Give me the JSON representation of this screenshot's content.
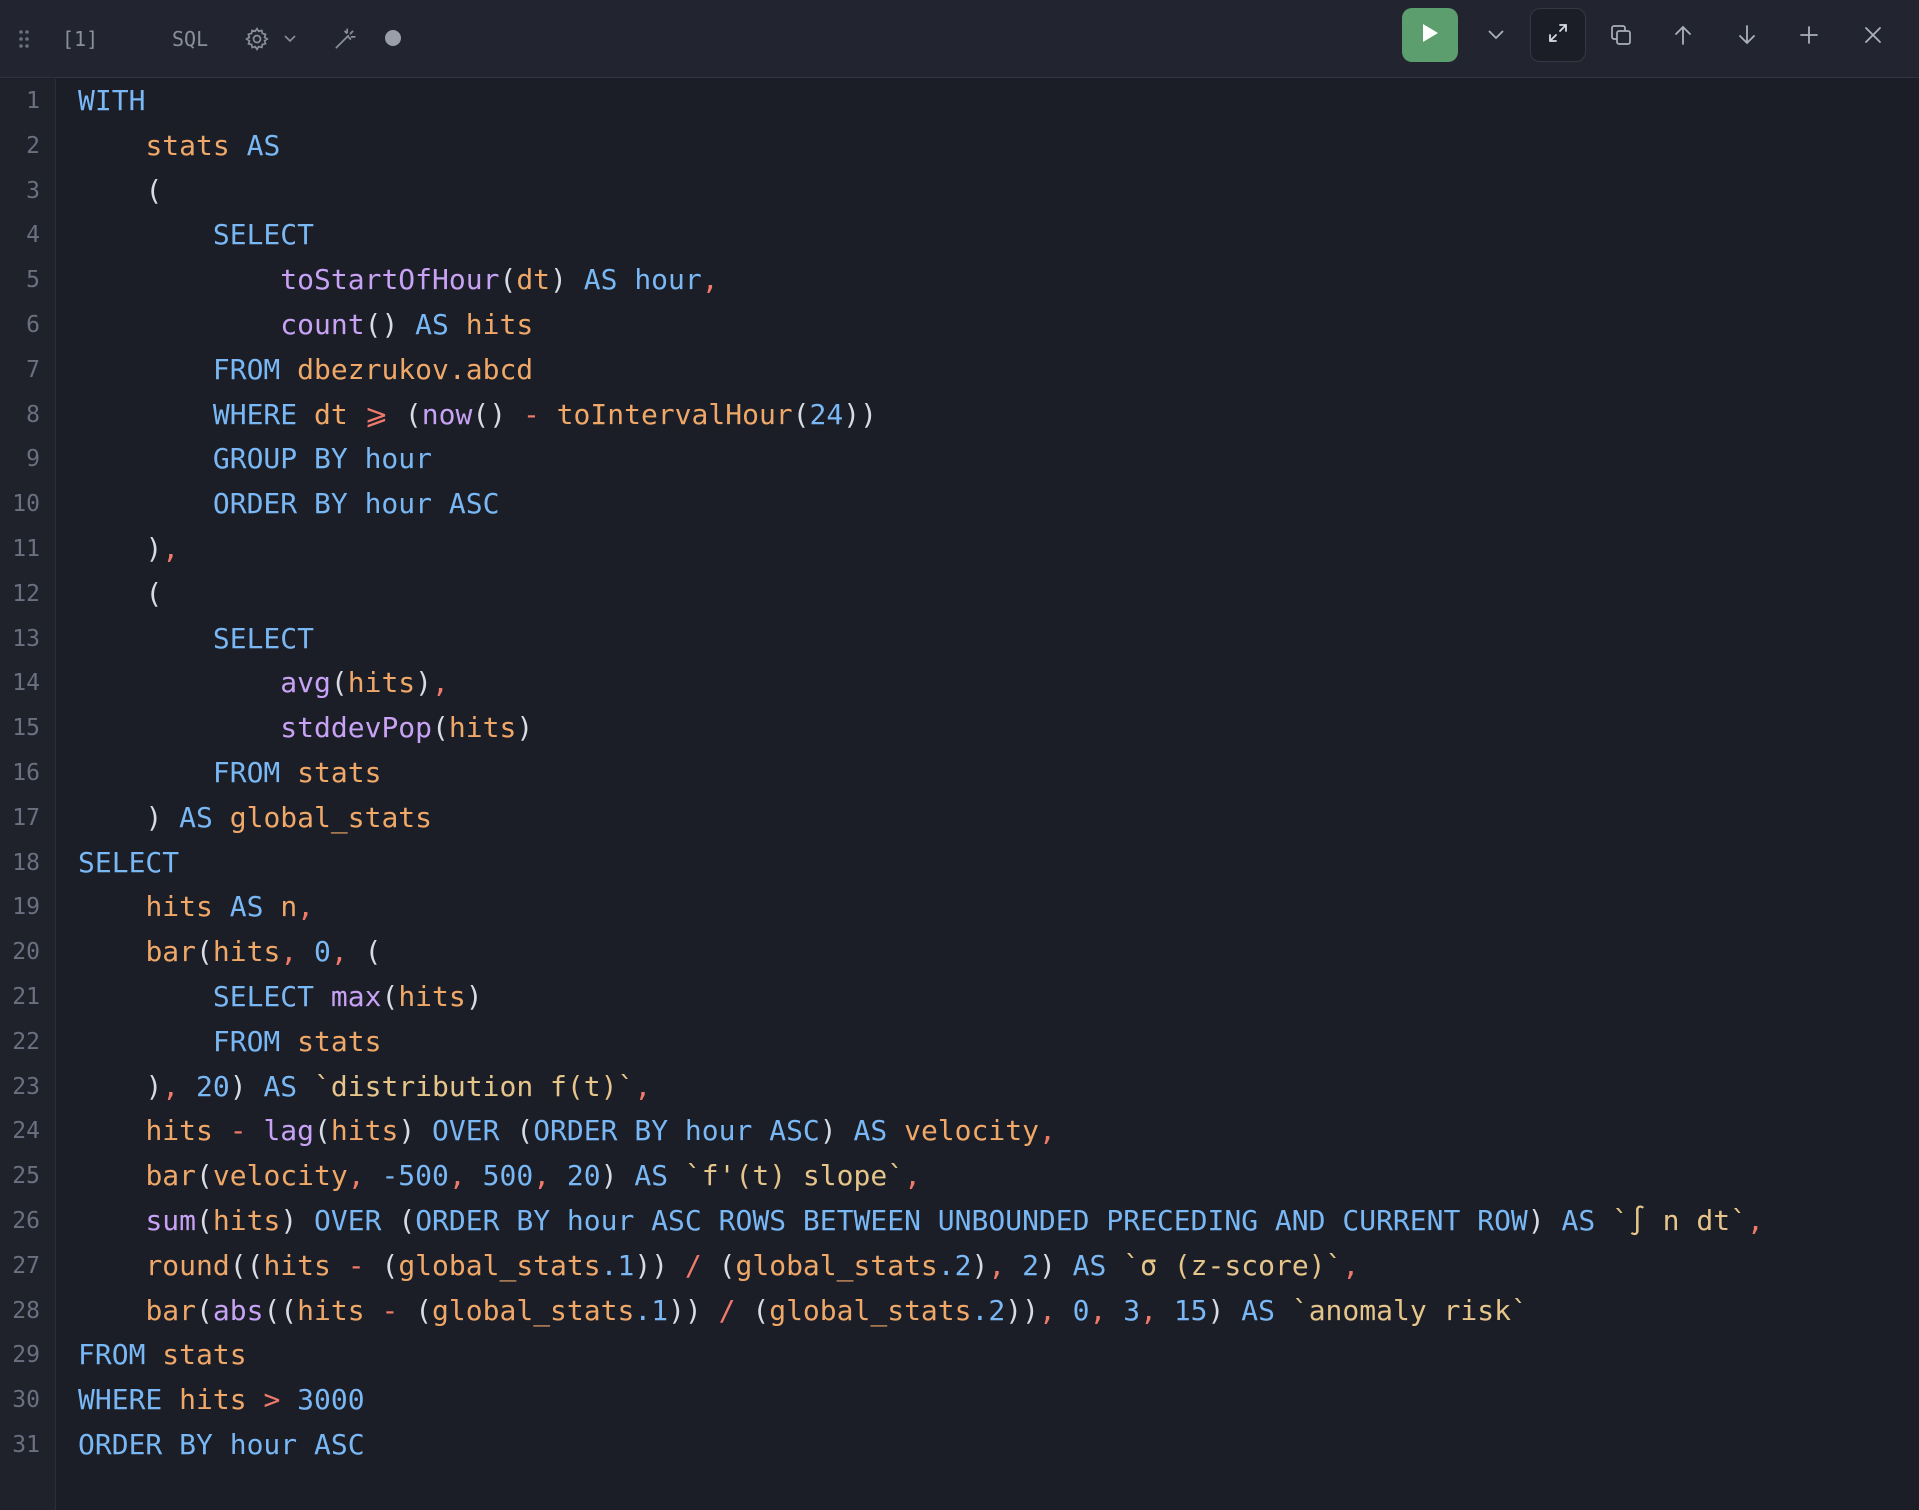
{
  "toolbar": {
    "cell_index": "[1]",
    "language": "SQL",
    "icons": {
      "drag": "drag-handle-icon",
      "settings": "gear-icon",
      "format": "magic-wand-icon",
      "status": "status-dot-icon",
      "run": "play-icon",
      "run_options": "chevron-down-icon",
      "expand": "expand-icon",
      "copy": "copy-icon",
      "move_up": "arrow-up-icon",
      "move_down": "arrow-down-icon",
      "add": "plus-icon",
      "close": "close-icon"
    },
    "colors": {
      "run_button": "#5c9e6e",
      "background": "#22252f"
    }
  },
  "editor": {
    "colors": {
      "keyword": "#79b8f5",
      "function": "#c8a2f5",
      "identifier": "#f0a868",
      "number": "#79b8f5",
      "operator": "#f07a6a",
      "string": "#e6c58a",
      "background": "#1b1e27"
    },
    "lines": [
      [
        [
          "k",
          "WITH"
        ]
      ],
      [
        [
          "w",
          "    "
        ],
        [
          "i",
          "stats"
        ],
        [
          "w",
          " "
        ],
        [
          "k",
          "AS"
        ]
      ],
      [
        [
          "w",
          "    "
        ],
        [
          "p",
          "("
        ]
      ],
      [
        [
          "w",
          "        "
        ],
        [
          "k",
          "SELECT"
        ]
      ],
      [
        [
          "w",
          "            "
        ],
        [
          "f",
          "toStartOfHour"
        ],
        [
          "p",
          "("
        ],
        [
          "i",
          "dt"
        ],
        [
          "p",
          ")"
        ],
        [
          "w",
          " "
        ],
        [
          "k",
          "AS"
        ],
        [
          "w",
          " "
        ],
        [
          "k",
          "hour"
        ],
        [
          "o",
          ","
        ]
      ],
      [
        [
          "w",
          "            "
        ],
        [
          "f",
          "count"
        ],
        [
          "p",
          "()"
        ],
        [
          "w",
          " "
        ],
        [
          "k",
          "AS"
        ],
        [
          "w",
          " "
        ],
        [
          "i",
          "hits"
        ]
      ],
      [
        [
          "w",
          "        "
        ],
        [
          "k",
          "FROM"
        ],
        [
          "w",
          " "
        ],
        [
          "i",
          "dbezrukov.abcd"
        ]
      ],
      [
        [
          "w",
          "        "
        ],
        [
          "k",
          "WHERE"
        ],
        [
          "w",
          " "
        ],
        [
          "i",
          "dt"
        ],
        [
          "w",
          " "
        ],
        [
          "o",
          "⩾"
        ],
        [
          "w",
          " "
        ],
        [
          "p",
          "("
        ],
        [
          "f",
          "now"
        ],
        [
          "p",
          "()"
        ],
        [
          "w",
          " "
        ],
        [
          "o",
          "-"
        ],
        [
          "w",
          " "
        ],
        [
          "i",
          "toIntervalHour"
        ],
        [
          "p",
          "("
        ],
        [
          "n",
          "24"
        ],
        [
          "p",
          "))"
        ]
      ],
      [
        [
          "w",
          "        "
        ],
        [
          "k",
          "GROUP BY"
        ],
        [
          "w",
          " "
        ],
        [
          "k",
          "hour"
        ]
      ],
      [
        [
          "w",
          "        "
        ],
        [
          "k",
          "ORDER BY"
        ],
        [
          "w",
          " "
        ],
        [
          "k",
          "hour"
        ],
        [
          "w",
          " "
        ],
        [
          "k",
          "ASC"
        ]
      ],
      [
        [
          "w",
          "    "
        ],
        [
          "p",
          ")"
        ],
        [
          "o",
          ","
        ]
      ],
      [
        [
          "w",
          "    "
        ],
        [
          "p",
          "("
        ]
      ],
      [
        [
          "w",
          "        "
        ],
        [
          "k",
          "SELECT"
        ]
      ],
      [
        [
          "w",
          "            "
        ],
        [
          "f",
          "avg"
        ],
        [
          "p",
          "("
        ],
        [
          "i",
          "hits"
        ],
        [
          "p",
          ")"
        ],
        [
          "o",
          ","
        ]
      ],
      [
        [
          "w",
          "            "
        ],
        [
          "f",
          "stddevPop"
        ],
        [
          "p",
          "("
        ],
        [
          "i",
          "hits"
        ],
        [
          "p",
          ")"
        ]
      ],
      [
        [
          "w",
          "        "
        ],
        [
          "k",
          "FROM"
        ],
        [
          "w",
          " "
        ],
        [
          "i",
          "stats"
        ]
      ],
      [
        [
          "w",
          "    "
        ],
        [
          "p",
          ")"
        ],
        [
          "w",
          " "
        ],
        [
          "k",
          "AS"
        ],
        [
          "w",
          " "
        ],
        [
          "i",
          "global_stats"
        ]
      ],
      [
        [
          "k",
          "SELECT"
        ]
      ],
      [
        [
          "w",
          "    "
        ],
        [
          "i",
          "hits"
        ],
        [
          "w",
          " "
        ],
        [
          "k",
          "AS"
        ],
        [
          "w",
          " "
        ],
        [
          "i",
          "n"
        ],
        [
          "o",
          ","
        ]
      ],
      [
        [
          "w",
          "    "
        ],
        [
          "i",
          "bar"
        ],
        [
          "p",
          "("
        ],
        [
          "i",
          "hits"
        ],
        [
          "o",
          ","
        ],
        [
          "w",
          " "
        ],
        [
          "n",
          "0"
        ],
        [
          "o",
          ","
        ],
        [
          "w",
          " "
        ],
        [
          "p",
          "("
        ]
      ],
      [
        [
          "w",
          "        "
        ],
        [
          "k",
          "SELECT"
        ],
        [
          "w",
          " "
        ],
        [
          "f",
          "max"
        ],
        [
          "p",
          "("
        ],
        [
          "i",
          "hits"
        ],
        [
          "p",
          ")"
        ]
      ],
      [
        [
          "w",
          "        "
        ],
        [
          "k",
          "FROM"
        ],
        [
          "w",
          " "
        ],
        [
          "i",
          "stats"
        ]
      ],
      [
        [
          "w",
          "    "
        ],
        [
          "p",
          ")"
        ],
        [
          "o",
          ","
        ],
        [
          "w",
          " "
        ],
        [
          "n",
          "20"
        ],
        [
          "p",
          ")"
        ],
        [
          "w",
          " "
        ],
        [
          "k",
          "AS"
        ],
        [
          "w",
          " "
        ],
        [
          "s",
          "`distribution f(t)`"
        ],
        [
          "o",
          ","
        ]
      ],
      [
        [
          "w",
          "    "
        ],
        [
          "i",
          "hits"
        ],
        [
          "w",
          " "
        ],
        [
          "o",
          "-"
        ],
        [
          "w",
          " "
        ],
        [
          "f",
          "lag"
        ],
        [
          "p",
          "("
        ],
        [
          "i",
          "hits"
        ],
        [
          "p",
          ")"
        ],
        [
          "w",
          " "
        ],
        [
          "k",
          "OVER"
        ],
        [
          "w",
          " "
        ],
        [
          "p",
          "("
        ],
        [
          "k",
          "ORDER BY"
        ],
        [
          "w",
          " "
        ],
        [
          "k",
          "hour"
        ],
        [
          "w",
          " "
        ],
        [
          "k",
          "ASC"
        ],
        [
          "p",
          ")"
        ],
        [
          "w",
          " "
        ],
        [
          "k",
          "AS"
        ],
        [
          "w",
          " "
        ],
        [
          "i",
          "velocity"
        ],
        [
          "o",
          ","
        ]
      ],
      [
        [
          "w",
          "    "
        ],
        [
          "i",
          "bar"
        ],
        [
          "p",
          "("
        ],
        [
          "i",
          "velocity"
        ],
        [
          "o",
          ","
        ],
        [
          "w",
          " "
        ],
        [
          "n",
          "-500"
        ],
        [
          "o",
          ","
        ],
        [
          "w",
          " "
        ],
        [
          "n",
          "500"
        ],
        [
          "o",
          ","
        ],
        [
          "w",
          " "
        ],
        [
          "n",
          "20"
        ],
        [
          "p",
          ")"
        ],
        [
          "w",
          " "
        ],
        [
          "k",
          "AS"
        ],
        [
          "w",
          " "
        ],
        [
          "s",
          "`f'(t) slope`"
        ],
        [
          "o",
          ","
        ]
      ],
      [
        [
          "w",
          "    "
        ],
        [
          "f",
          "sum"
        ],
        [
          "p",
          "("
        ],
        [
          "i",
          "hits"
        ],
        [
          "p",
          ")"
        ],
        [
          "w",
          " "
        ],
        [
          "k",
          "OVER"
        ],
        [
          "w",
          " "
        ],
        [
          "p",
          "("
        ],
        [
          "k",
          "ORDER BY"
        ],
        [
          "w",
          " "
        ],
        [
          "k",
          "hour"
        ],
        [
          "w",
          " "
        ],
        [
          "k",
          "ASC ROWS BETWEEN UNBOUNDED PRECEDING AND CURRENT ROW"
        ],
        [
          "p",
          ")"
        ],
        [
          "w",
          " "
        ],
        [
          "k",
          "AS"
        ],
        [
          "w",
          " "
        ],
        [
          "s",
          "`∫ n dt`"
        ],
        [
          "o",
          ","
        ]
      ],
      [
        [
          "w",
          "    "
        ],
        [
          "i",
          "round"
        ],
        [
          "p",
          "(("
        ],
        [
          "i",
          "hits"
        ],
        [
          "w",
          " "
        ],
        [
          "o",
          "-"
        ],
        [
          "w",
          " "
        ],
        [
          "p",
          "("
        ],
        [
          "i",
          "global_stats"
        ],
        [
          "n",
          ".1"
        ],
        [
          "p",
          "))"
        ],
        [
          "w",
          " "
        ],
        [
          "o",
          "/"
        ],
        [
          "w",
          " "
        ],
        [
          "p",
          "("
        ],
        [
          "i",
          "global_stats"
        ],
        [
          "n",
          ".2"
        ],
        [
          "p",
          ")"
        ],
        [
          "o",
          ","
        ],
        [
          "w",
          " "
        ],
        [
          "n",
          "2"
        ],
        [
          "p",
          ")"
        ],
        [
          "w",
          " "
        ],
        [
          "k",
          "AS"
        ],
        [
          "w",
          " "
        ],
        [
          "s",
          "`σ (z-score)`"
        ],
        [
          "o",
          ","
        ]
      ],
      [
        [
          "w",
          "    "
        ],
        [
          "i",
          "bar"
        ],
        [
          "p",
          "("
        ],
        [
          "f",
          "abs"
        ],
        [
          "p",
          "(("
        ],
        [
          "i",
          "hits"
        ],
        [
          "w",
          " "
        ],
        [
          "o",
          "-"
        ],
        [
          "w",
          " "
        ],
        [
          "p",
          "("
        ],
        [
          "i",
          "global_stats"
        ],
        [
          "n",
          ".1"
        ],
        [
          "p",
          "))"
        ],
        [
          "w",
          " "
        ],
        [
          "o",
          "/"
        ],
        [
          "w",
          " "
        ],
        [
          "p",
          "("
        ],
        [
          "i",
          "global_stats"
        ],
        [
          "n",
          ".2"
        ],
        [
          "p",
          "))"
        ],
        [
          "o",
          ","
        ],
        [
          "w",
          " "
        ],
        [
          "n",
          "0"
        ],
        [
          "o",
          ","
        ],
        [
          "w",
          " "
        ],
        [
          "n",
          "3"
        ],
        [
          "o",
          ","
        ],
        [
          "w",
          " "
        ],
        [
          "n",
          "15"
        ],
        [
          "p",
          ")"
        ],
        [
          "w",
          " "
        ],
        [
          "k",
          "AS"
        ],
        [
          "w",
          " "
        ],
        [
          "s",
          "`anomaly risk`"
        ]
      ],
      [
        [
          "k",
          "FROM"
        ],
        [
          "w",
          " "
        ],
        [
          "i",
          "stats"
        ]
      ],
      [
        [
          "k",
          "WHERE"
        ],
        [
          "w",
          " "
        ],
        [
          "i",
          "hits"
        ],
        [
          "w",
          " "
        ],
        [
          "o",
          ">"
        ],
        [
          "w",
          " "
        ],
        [
          "n",
          "3000"
        ]
      ],
      [
        [
          "k",
          "ORDER BY"
        ],
        [
          "w",
          " "
        ],
        [
          "k",
          "hour"
        ],
        [
          "w",
          " "
        ],
        [
          "k",
          "ASC"
        ]
      ]
    ]
  }
}
